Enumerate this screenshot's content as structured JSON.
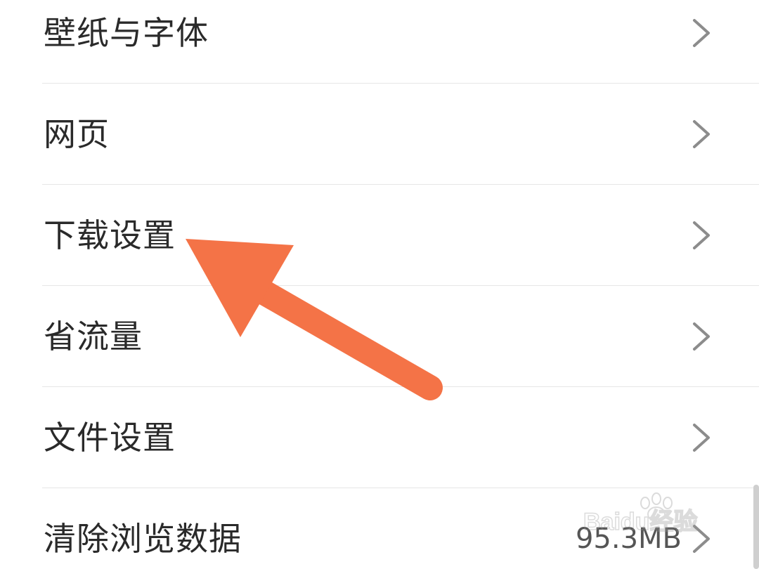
{
  "settings": {
    "items": [
      {
        "label": "壁纸与字体"
      },
      {
        "label": "网页"
      },
      {
        "label": "下载设置"
      },
      {
        "label": "省流量"
      },
      {
        "label": "文件设置"
      },
      {
        "label": "清除浏览数据",
        "value": "95.3MB"
      }
    ]
  },
  "watermark": {
    "text": "Baidu经验"
  },
  "icons": {
    "row_chevron": "chevron-right-icon",
    "annotation": "arrow-pointer"
  },
  "colors": {
    "background": "#ffffff",
    "text": "#2a2a2a",
    "chevron": "#8c8c8c",
    "divider": "#e6e6e6",
    "annotation_arrow": "#f47347"
  }
}
